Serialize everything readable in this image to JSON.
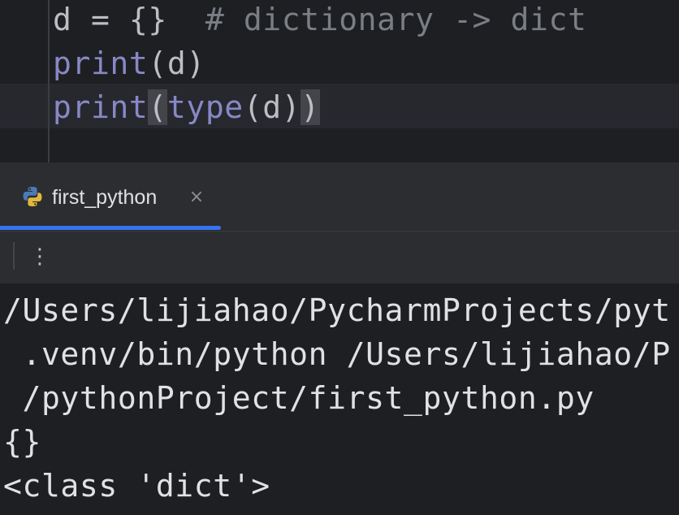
{
  "editor": {
    "lines": [
      {
        "var": "d",
        "assign": " = ",
        "value": "{}",
        "gap": "  ",
        "comment": "# dictionary -> dict"
      },
      {
        "func": "print",
        "open": "(",
        "arg": "d",
        "close": ")"
      },
      {
        "func": "print",
        "open": "(",
        "inner_func": "type",
        "inner_open": "(",
        "arg": "d",
        "inner_close": ")",
        "close": ")"
      }
    ]
  },
  "run_panel": {
    "tab_label": "first_python",
    "tab_close": "×",
    "more_label": "⋮"
  },
  "console": {
    "lines": [
      "/Users/lijiahao/PycharmProjects/pyt",
      " .venv/bin/python /Users/lijiahao/P",
      " /pythonProject/first_python.py",
      "{}",
      "<class 'dict'>"
    ]
  },
  "colors": {
    "background": "#1e1f22",
    "panel": "#2b2d30",
    "builtin": "#8888c6",
    "comment": "#7a7e85",
    "text": "#bcbec4",
    "accent": "#3574f0"
  }
}
